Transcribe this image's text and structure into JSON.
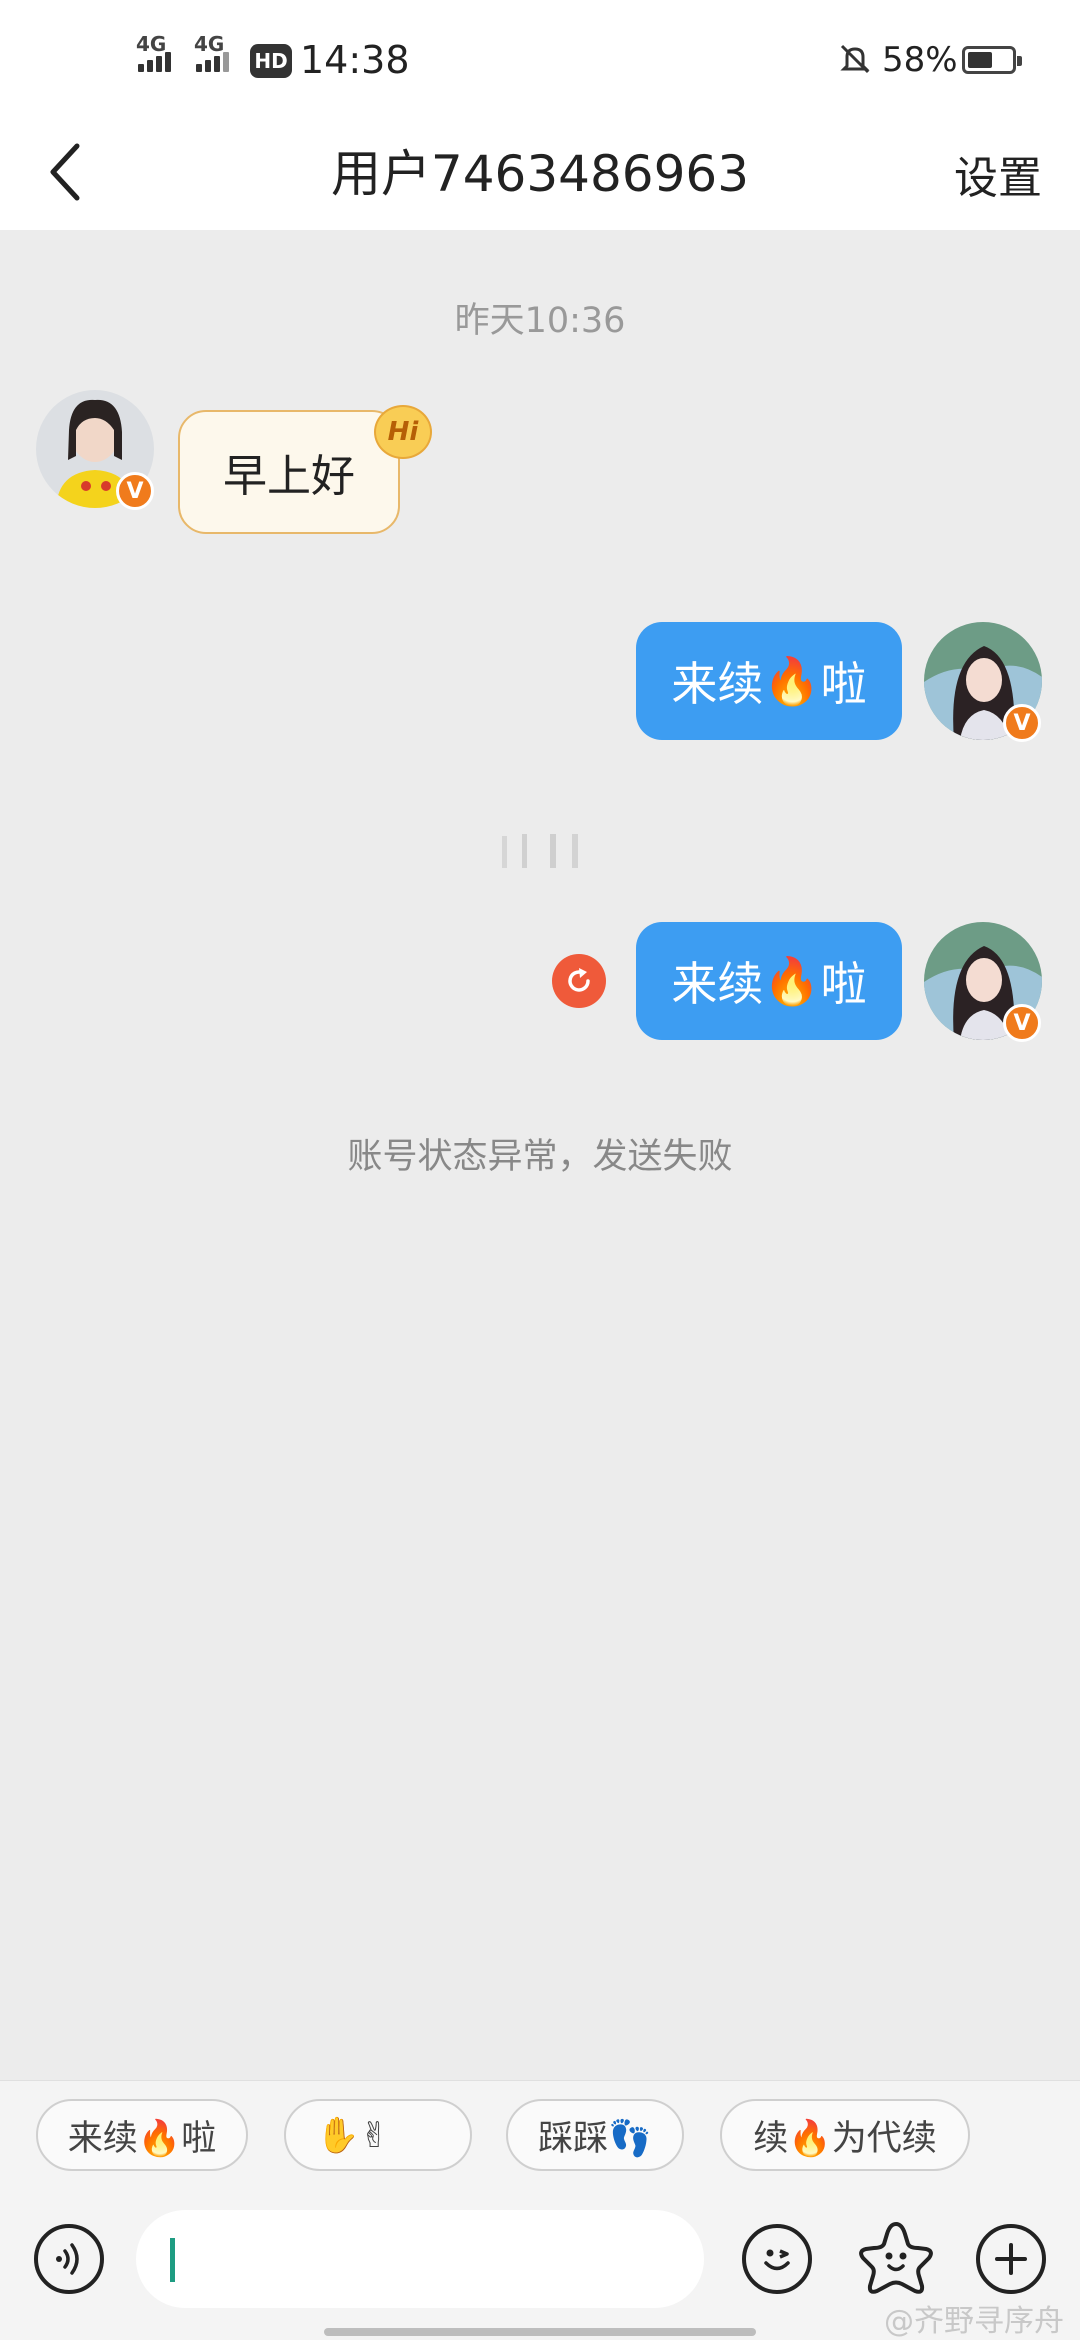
{
  "status_bar": {
    "network1": "4G",
    "network2": "4G",
    "hd_badge": "HD",
    "time": "14:38",
    "battery_text": "58%",
    "battery_level": 0.58
  },
  "header": {
    "back_icon": "chevron-left-icon",
    "title": "用户7463486963",
    "settings_label": "设置"
  },
  "chat": {
    "timestamp": "昨天10:36",
    "messages": [
      {
        "direction": "incoming",
        "text": "早上好",
        "badge": "Hi"
      },
      {
        "direction": "outgoing",
        "text_before": "来续",
        "emoji": "🔥",
        "text_after": "啦"
      },
      {
        "direction": "outgoing",
        "text_before": "来续",
        "emoji": "🔥",
        "text_after": "啦",
        "status": "failed"
      }
    ],
    "notice": "账号状态异常，发送失败"
  },
  "quick_replies": [
    {
      "label": "来续🔥啦"
    },
    {
      "label": "✋✌"
    },
    {
      "label": "踩踩👣"
    },
    {
      "label": "续🔥为代续"
    }
  ],
  "input_bar": {
    "voice_icon": "voice-icon",
    "emoji_icon": "smiley-icon",
    "sticker_icon": "star-face-icon",
    "add_icon": "plus-circle-icon"
  },
  "watermark": "@齐野寻序舟",
  "colors": {
    "outgoing_bubble": "#3d9df2",
    "incoming_bubble": "#fdf8ec",
    "vip_badge": "#f07b1c",
    "retry": "#ef5a3a",
    "cursor": "#1e9c82"
  }
}
